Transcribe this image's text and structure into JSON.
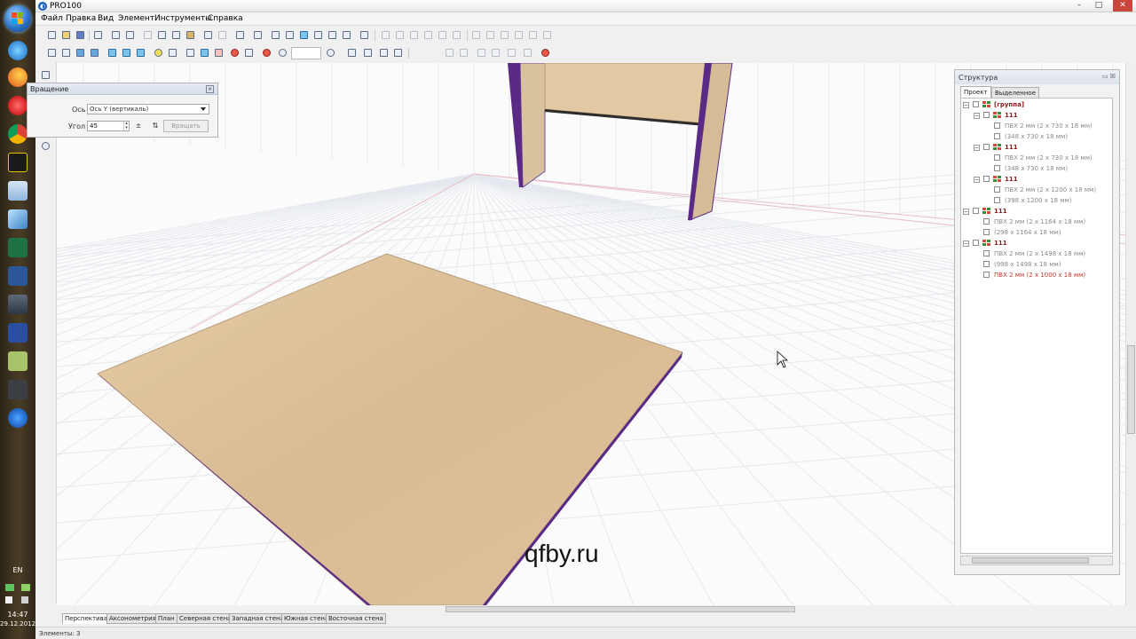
{
  "app": {
    "title": "PRO100"
  },
  "menu": [
    "Файл",
    "Правка",
    "Вид",
    "Элемент",
    "Инструменты",
    "Справка"
  ],
  "dialog": {
    "title": "Вращение",
    "axis_label": "Ось",
    "axis_value": "Ось Y (вертикаль)",
    "angle_label": "Угол",
    "angle_value": "45",
    "rotate_button": "Вращать"
  },
  "structure": {
    "title": "Структура",
    "tabs": [
      "Проект",
      "Выделенное"
    ],
    "tree": [
      {
        "level": 0,
        "label": "[группа]",
        "kind": "group"
      },
      {
        "level": 1,
        "label": "111",
        "kind": "group"
      },
      {
        "level": 2,
        "label": "ПВХ 2 мм   (2 x 730 x 18 мм)",
        "kind": "part"
      },
      {
        "level": 2,
        "label": "(348 x 730 x 18 мм)",
        "kind": "part"
      },
      {
        "level": 1,
        "label": "111",
        "kind": "group"
      },
      {
        "level": 2,
        "label": "ПВХ 2 мм   (2 x 730 x 18 мм)",
        "kind": "part"
      },
      {
        "level": 2,
        "label": "(348 x 730 x 18 мм)",
        "kind": "part"
      },
      {
        "level": 1,
        "label": "111",
        "kind": "group"
      },
      {
        "level": 2,
        "label": "ПВХ 2 мм   (2 x 1200 x 18 мм)",
        "kind": "part"
      },
      {
        "level": 2,
        "label": "(398 x 1200 x 18 мм)",
        "kind": "part"
      },
      {
        "level": 0,
        "label": "111",
        "kind": "group"
      },
      {
        "level": 1,
        "label": "ПВХ 2 мм   (2 x 1164 x 18 мм)",
        "kind": "part"
      },
      {
        "level": 1,
        "label": "(298 x 1164 x 18 мм)",
        "kind": "part"
      },
      {
        "level": 0,
        "label": "111",
        "kind": "group"
      },
      {
        "level": 1,
        "label": "ПВХ 2 мм   (2 x 1498 x 18 мм)",
        "kind": "part"
      },
      {
        "level": 1,
        "label": "(998 x 1498 x 18 мм)",
        "kind": "part"
      },
      {
        "level": 1,
        "label": "ПВХ 2 мм   (2 x 1000 x 18 мм)",
        "kind": "selected"
      }
    ]
  },
  "view_tabs": [
    "Перспектива",
    "Аксонометрия",
    "План",
    "Северная стена",
    "Западная стена",
    "Южная стена",
    "Восточная стена"
  ],
  "status": {
    "text": "Элементы: 3"
  },
  "watermark": "qfby.ru",
  "taskbar": {
    "lang": "EN",
    "time": "14:47",
    "date": "29.12.2012"
  },
  "colors": {
    "wood": "#dcc09b",
    "edge": "#5a2a86",
    "grid": "#e7bfc8",
    "accent": "#1d5fb5"
  }
}
